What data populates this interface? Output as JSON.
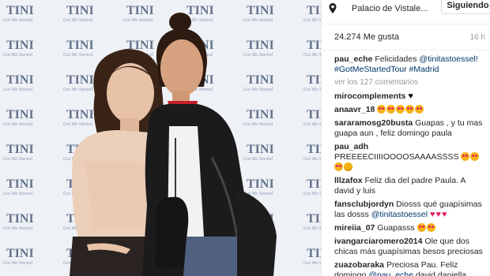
{
  "header": {
    "location": "Palacio de Vistale...",
    "follow_label": "Siguiendo"
  },
  "post": {
    "likes": "24.274 Me gusta",
    "time_ago": "16 h",
    "caption_user": "pau_eche",
    "caption_text": " Felicidades ",
    "caption_mention": "@tinitastoessel!",
    "caption_tags": "#GotMeStartedTour #Madrid",
    "view_all": "ver los 127 comentarios"
  },
  "comments": [
    {
      "user": "mirocomplements",
      "text": "",
      "emoji": [
        "heart-black"
      ]
    },
    {
      "user": "anaavr_18",
      "text": "",
      "emoji": [
        "eyes",
        "eyes",
        "eyes",
        "eyes",
        "eyes"
      ]
    },
    {
      "user": "sararamosg20busta",
      "text": " Guapas , y tu mas guapa aun , feliz domingo paula",
      "emoji": []
    },
    {
      "user": "pau_adh",
      "text": " PREEEECIIIIOOOOSAAAASSSS",
      "emoji": [
        "eyes",
        "eyes",
        "eyes",
        "face"
      ]
    },
    {
      "user": "lllzafox",
      "text": " Feliz dia del padre Paula. A david y luis",
      "emoji": []
    },
    {
      "user": "fansclubjordyn",
      "text": " Diosss qué guapísimas las dosss ",
      "mention": "@tinitastoessel",
      "emoji": [
        "heart-red",
        "heart-red",
        "heart-red"
      ]
    },
    {
      "user": "mireiia_07",
      "text": " Guapasss",
      "emoji": [
        "eyes",
        "eyes"
      ]
    },
    {
      "user": "ivangarciaromero2014",
      "text": " Ole que dos chicas más guapísimas besos preciosas",
      "emoji": []
    },
    {
      "user": "zuazobaraka",
      "text": " Preciosa Pau. Feliz domingo ",
      "mention": "@pau_eche",
      "text_after": " david daniella",
      "emoji": []
    }
  ],
  "photo": {
    "backdrop_logo": "TINI",
    "backdrop_sub": "Got Me Started"
  },
  "colors": {
    "link": "#003569",
    "muted": "#999999",
    "text": "#262626",
    "backdrop": "#e9edf3"
  }
}
